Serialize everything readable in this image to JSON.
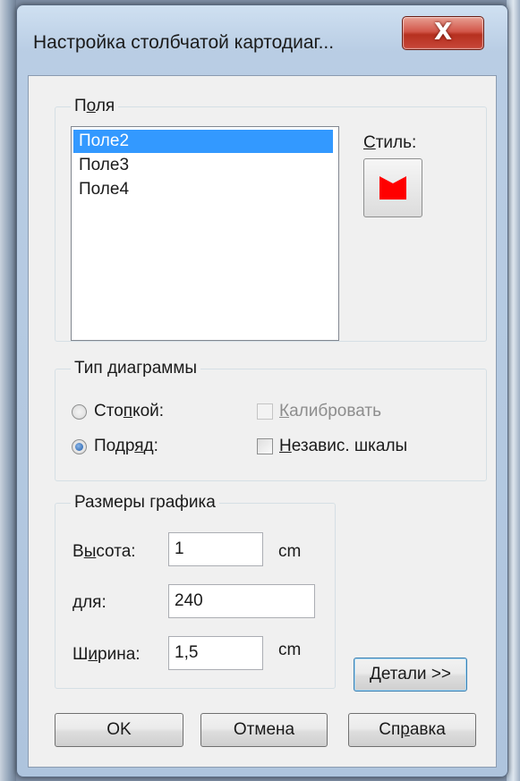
{
  "window": {
    "title": "Настройка столбчатой картодиаг...",
    "close_glyph": "X"
  },
  "fields_group": {
    "title_pre": "П",
    "title_u": "о",
    "title_post": "ля",
    "items": [
      "Поле2",
      "Поле3",
      "Поле4"
    ],
    "selected_index": 0
  },
  "style": {
    "label_u": "С",
    "label_post": "тиль:",
    "swatch_color": "#ff0000"
  },
  "chart_type_group": {
    "title": "Тип диаграммы",
    "stacked": {
      "pre": "Сто",
      "u": "п",
      "post": "кой:",
      "checked": false
    },
    "in_row": {
      "pre": "Подр",
      "u": "я",
      "post": "д:",
      "checked": true
    },
    "calibrate": {
      "u": "К",
      "post": "алибровать",
      "checked": false,
      "disabled": true
    },
    "independent_scales": {
      "u": "Н",
      "post": "езавис. шкалы",
      "checked": false,
      "disabled": false
    }
  },
  "size_group": {
    "title": "Размеры графика",
    "height": {
      "pre": "В",
      "u": "ы",
      "post": "сота:",
      "value": "1",
      "unit": "cm"
    },
    "for": {
      "pre": "",
      "u": "д",
      "post": "ля:",
      "value": "240"
    },
    "width": {
      "pre": "Ш",
      "u": "и",
      "post": "рина:",
      "value": "1,5",
      "unit": "cm"
    }
  },
  "buttons": {
    "details": {
      "pre": "",
      "u": "Д",
      "post": "етали >>"
    },
    "ok": "OK",
    "cancel": "Отмена",
    "help": {
      "pre": "Сп",
      "u": "р",
      "post": "авка"
    }
  },
  "colors": {
    "selection": "#3399ff",
    "close_button": "#c8473a",
    "dialog_face": "#f0f0f0"
  }
}
